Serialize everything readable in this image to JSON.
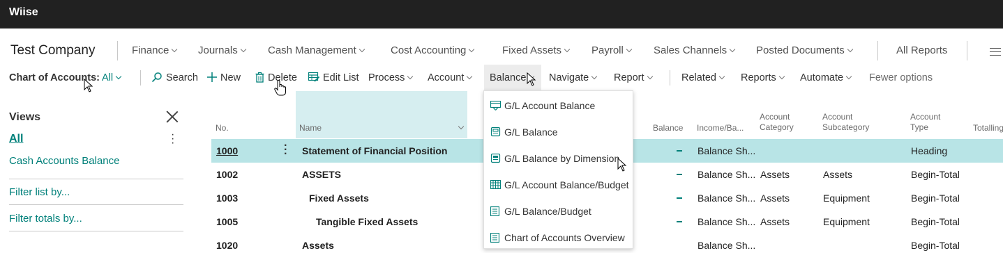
{
  "app": {
    "brand": "Wiise"
  },
  "nav": {
    "company": "Test Company",
    "items": [
      {
        "label": "Finance"
      },
      {
        "label": "Journals"
      },
      {
        "label": "Cash Management"
      },
      {
        "label": "Cost Accounting"
      },
      {
        "label": "Fixed Assets"
      },
      {
        "label": "Payroll"
      },
      {
        "label": "Sales Channels"
      },
      {
        "label": "Posted Documents"
      }
    ],
    "all_reports": "All Reports"
  },
  "actions": {
    "page_title": "Chart of Accounts:",
    "filter": "All",
    "search": "Search",
    "new": "New",
    "delete": "Delete",
    "edit_list": "Edit List",
    "process": "Process",
    "account": "Account",
    "balance": "Balance",
    "navigate": "Navigate",
    "report": "Report",
    "related": "Related",
    "reports": "Reports",
    "automate": "Automate",
    "fewer_options": "Fewer options"
  },
  "views": {
    "title": "Views",
    "all": "All",
    "cash_accounts": "Cash Accounts Balance",
    "filter_list": "Filter list by...",
    "filter_totals": "Filter totals by..."
  },
  "table": {
    "columns": {
      "no": "No.",
      "name": "Name",
      "balance": "Balance",
      "income_balance": "Income/Ba...",
      "account_category": [
        "Account",
        "Category"
      ],
      "account_subcategory": [
        "Account",
        "Subcategory"
      ],
      "account_type": [
        "Account",
        "Type"
      ],
      "totalling": "Totalling"
    },
    "rows": [
      {
        "no": "1000",
        "name": "Statement of Financial Position",
        "balance": "_",
        "income": "Balance Sh...",
        "category": "",
        "subcategory": "",
        "type": "Heading"
      },
      {
        "no": "1002",
        "name": "ASSETS",
        "balance": "_",
        "income": "Balance Sh...",
        "category": "Assets",
        "subcategory": "Assets",
        "type": "Begin-Total"
      },
      {
        "no": "1003",
        "name": "Fixed Assets",
        "balance": "_",
        "income": "Balance Sh...",
        "category": "Assets",
        "subcategory": "Equipment",
        "type": "Begin-Total"
      },
      {
        "no": "1005",
        "name": "Tangible Fixed Assets",
        "balance": "_",
        "income": "Balance Sh...",
        "category": "Assets",
        "subcategory": "Equipment",
        "type": "Begin-Total"
      },
      {
        "no": "1020",
        "name": "Assets",
        "balance": "",
        "income": "Balance Sh...",
        "category": "",
        "subcategory": "",
        "type": "Begin-Total"
      }
    ]
  },
  "balance_menu": {
    "items": [
      {
        "label": "G/L Account Balance",
        "icon": "gl-balance-icon"
      },
      {
        "label": "G/L Balance",
        "icon": "gl-balance-icon"
      },
      {
        "label": "G/L Balance by Dimension",
        "icon": "dimension-icon"
      },
      {
        "label": "G/L Account Balance/Budget",
        "icon": "budget-grid-icon"
      },
      {
        "label": "G/L Balance/Budget",
        "icon": "report-icon"
      },
      {
        "label": "Chart of Accounts Overview",
        "icon": "report-icon"
      }
    ]
  },
  "colors": {
    "accent": "#00807a",
    "topbar": "#212121",
    "selected_row": "#b8e4e6"
  }
}
